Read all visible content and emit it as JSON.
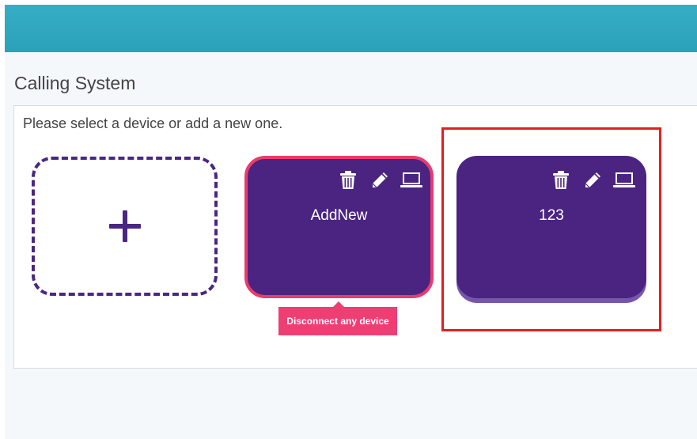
{
  "page": {
    "title": "Calling System",
    "instruction": "Please select a device or add a new one."
  },
  "add_card": {
    "icon": "plus-icon"
  },
  "devices": [
    {
      "name": "AddNew",
      "selected": true,
      "icons": [
        "trash-icon",
        "pencil-icon",
        "laptop-icon"
      ]
    },
    {
      "name": "123",
      "selected": false,
      "icons": [
        "trash-icon",
        "pencil-icon",
        "laptop-icon"
      ]
    }
  ],
  "tooltip": {
    "text": "Disconnect any device"
  },
  "colors": {
    "header": "#2ba1b8",
    "card": "#4a2480",
    "card_shadow": "#7656ad",
    "active_border": "#ea3b6e",
    "tooltip": "#ef3e73",
    "highlight": "#e02020"
  }
}
